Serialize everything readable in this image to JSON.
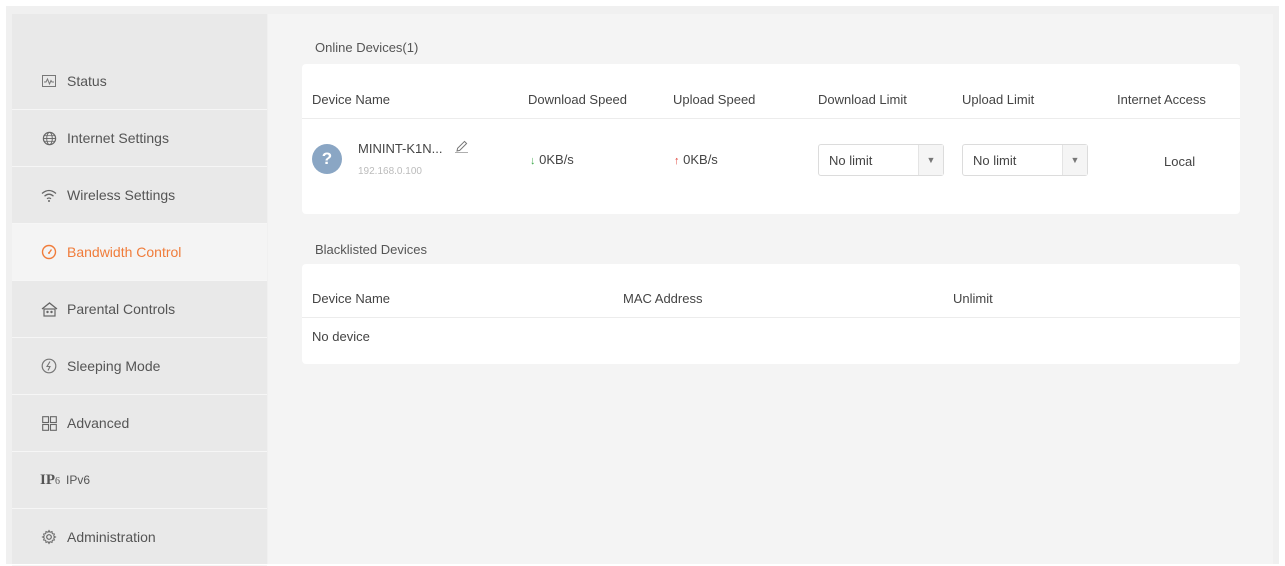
{
  "sidebar": {
    "items": [
      {
        "label": "Status",
        "icon": "status-icon",
        "active": false
      },
      {
        "label": "Internet Settings",
        "icon": "globe-icon",
        "active": false
      },
      {
        "label": "Wireless Settings",
        "icon": "wifi-icon",
        "active": false
      },
      {
        "label": "Bandwidth Control",
        "icon": "gauge-icon",
        "active": true
      },
      {
        "label": "Parental Controls",
        "icon": "house-icon",
        "active": false
      },
      {
        "label": "Sleeping Mode",
        "icon": "sleep-icon",
        "active": false
      },
      {
        "label": "Advanced",
        "icon": "grid-icon",
        "active": false
      },
      {
        "label": "IPv6",
        "badge": "IP",
        "badge_sub": "6",
        "icon": "ipv6-icon",
        "active": false
      },
      {
        "label": "Administration",
        "icon": "gear-icon",
        "active": false
      }
    ]
  },
  "online": {
    "title": "Online Devices(1)",
    "headers": [
      "Device Name",
      "Download Speed",
      "Upload Speed",
      "Download Limit",
      "Upload Limit",
      "Internet Access"
    ],
    "device": {
      "name": "MININT-K1N...",
      "ip": "192.168.0.100",
      "download_speed": "0KB/s",
      "upload_speed": "0KB/s",
      "download_limit": "No limit",
      "upload_limit": "No limit",
      "internet_access": "Local"
    }
  },
  "blacklist": {
    "title": "Blacklisted Devices",
    "headers": [
      "Device Name",
      "MAC Address",
      "Unlimit"
    ],
    "empty": "No device"
  },
  "colors": {
    "accent": "#f07c3a",
    "download_arrow": "#3ea84b",
    "upload_arrow": "#e0443c"
  }
}
